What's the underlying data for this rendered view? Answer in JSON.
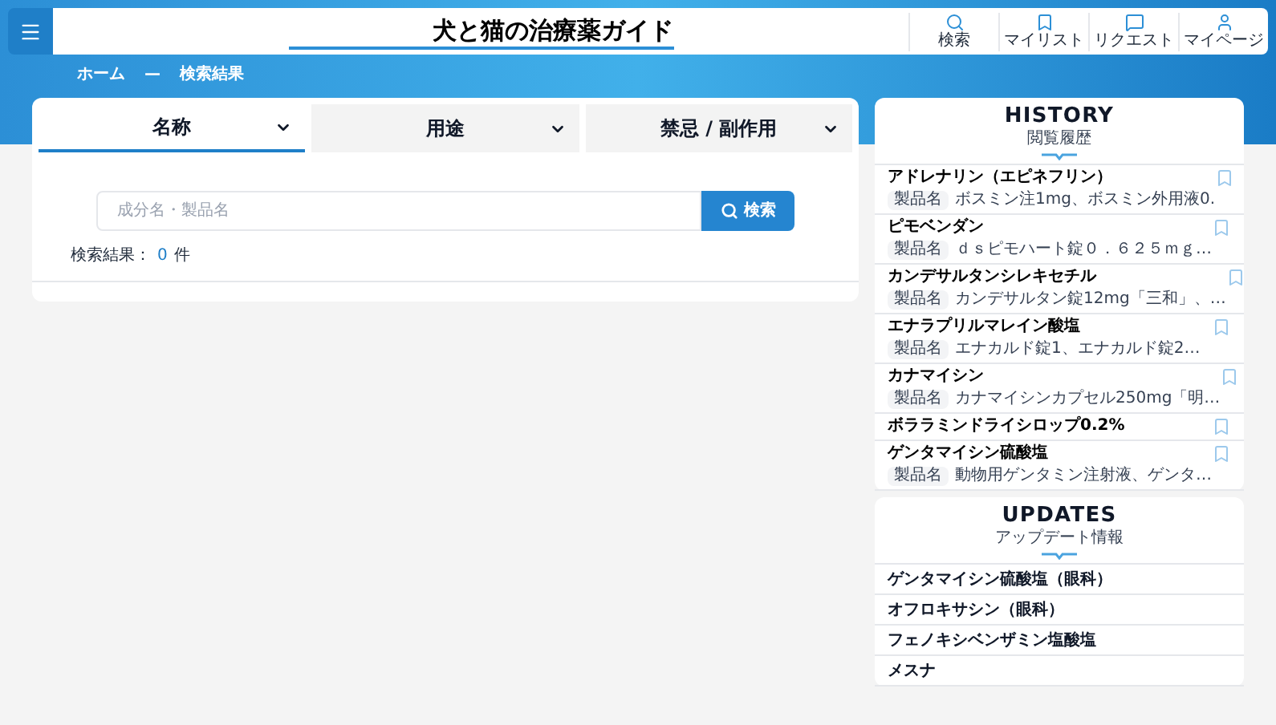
{
  "header": {
    "logo": "犬と猫の治療薬ガイド",
    "nav": [
      {
        "label": "検索",
        "kind": "search"
      },
      {
        "label": "マイリスト",
        "kind": "bookmark"
      },
      {
        "label": "リクエスト",
        "kind": "request"
      },
      {
        "label": "マイページ",
        "kind": "user"
      }
    ]
  },
  "breadcrumb": [
    "ホーム",
    "—",
    "検索結果"
  ],
  "tabs": [
    {
      "label": "名称",
      "selected": true
    },
    {
      "label": "用途",
      "selected": false
    },
    {
      "label": "禁忌 / 副作用",
      "selected": false
    }
  ],
  "search": {
    "placeholder": "成分名・製品名",
    "button": "検索"
  },
  "result": {
    "label": "検索結果：",
    "count": "0",
    "unit": "件"
  },
  "history": {
    "title": "HISTORY",
    "subtitle": "閲覧履歴",
    "items": [
      {
        "name": "アドレナリン（エピネフリン）",
        "badge": "製品名",
        "products": "ボスミン注1mg、ボスミン外用液0."
      },
      {
        "name": "ピモベンダン",
        "badge": "製品名",
        "products": "ｄｓピモハート錠０．６２５ｍｇ…"
      },
      {
        "name": "カンデサルタンシレキセチル",
        "badge": "製品名",
        "products": "カンデサルタン錠12mg「三和」、…"
      },
      {
        "name": "エナラプリルマレイン酸塩",
        "badge": "製品名",
        "products": "エナカルド錠1、エナカルド錠2…"
      },
      {
        "name": "カナマイシン",
        "badge": "製品名",
        "products": "カナマイシンカプセル250mg「明…"
      },
      {
        "name": "ボララミンドライシロップ0.2%"
      },
      {
        "name": "ゲンタマイシン硫酸塩",
        "badge": "製品名",
        "products": "動物用ゲンタミン注射液、ゲンタ…"
      }
    ]
  },
  "updates": {
    "title": "UPDATES",
    "subtitle": "アップデート情報",
    "items": [
      "ゲンタマイシン硫酸塩（眼科）",
      "オフロキサシン（眼科）",
      "フェノキシベンザミン塩酸塩",
      "メスナ"
    ]
  }
}
